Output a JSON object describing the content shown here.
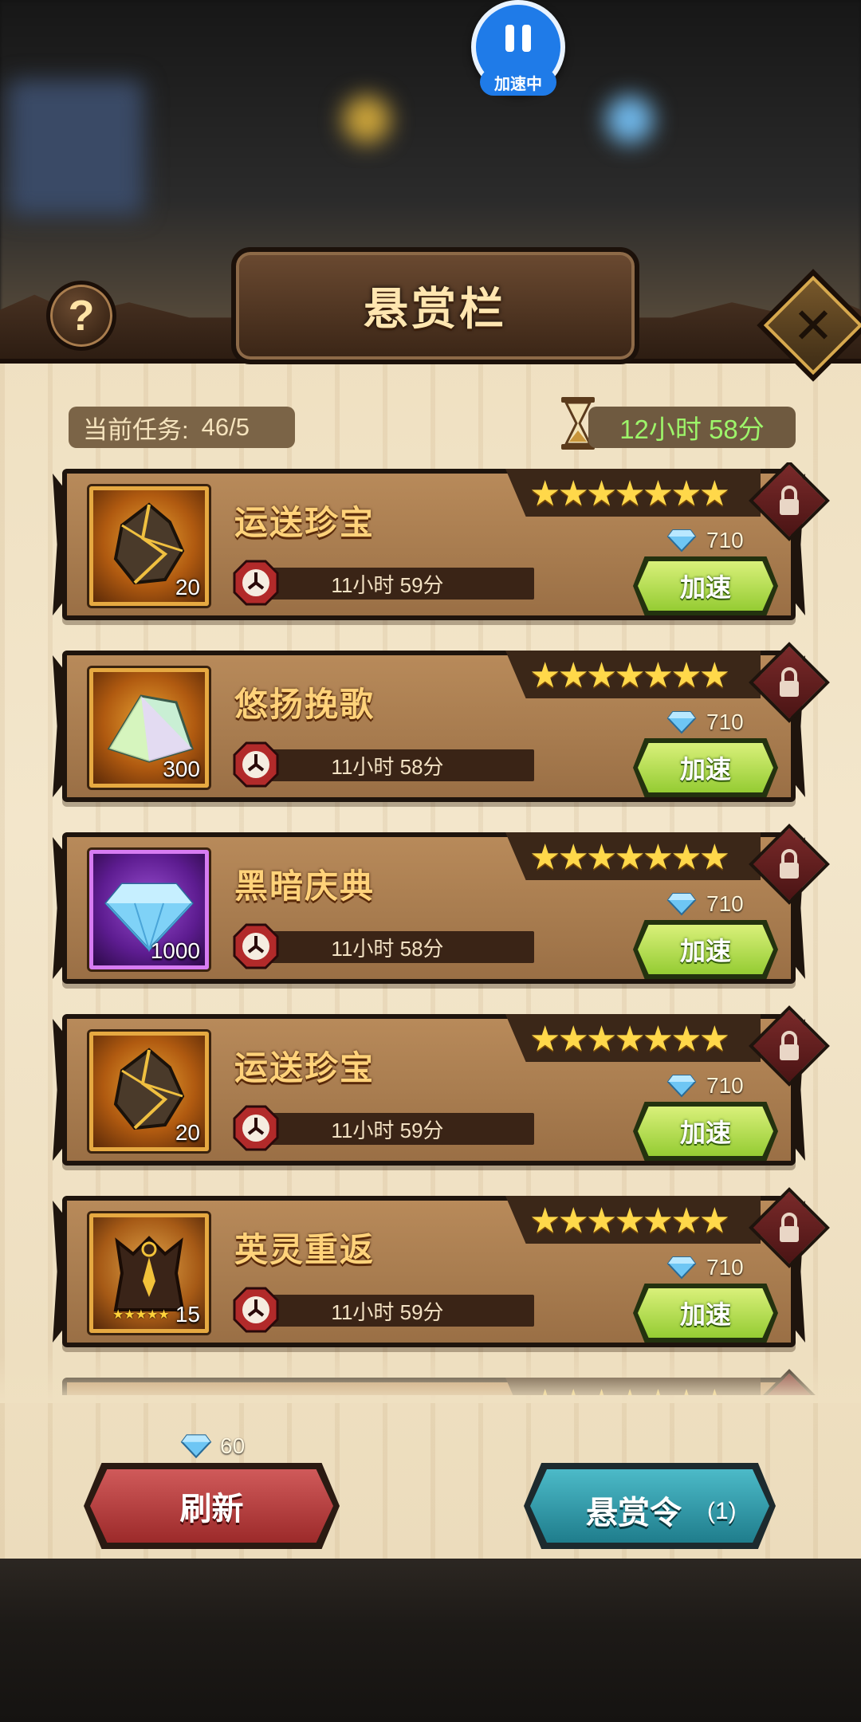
{
  "speed_indicator": {
    "label": "加速中"
  },
  "header": {
    "title": "悬赏栏",
    "help_symbol": "?",
    "close_symbol": "✕"
  },
  "info": {
    "current_task_label": "当前任务:",
    "current_task_value": "46/5",
    "refresh_timer": "12小时 58分"
  },
  "cards": [
    {
      "title": "运送珍宝",
      "item_icon": "ore-chunk-icon",
      "frame": "gold",
      "qty": "20",
      "star_count": 7,
      "gem_cost": "710",
      "time": "11小时 59分",
      "button": "加速"
    },
    {
      "title": "悠扬挽歌",
      "item_icon": "crystal-shard-icon",
      "frame": "gold",
      "qty": "300",
      "star_count": 7,
      "gem_cost": "710",
      "time": "11小时 58分",
      "button": "加速"
    },
    {
      "title": "黑暗庆典",
      "item_icon": "diamond-icon",
      "frame": "purple",
      "qty": "1000",
      "star_count": 7,
      "gem_cost": "710",
      "time": "11小时 58分",
      "button": "加速"
    },
    {
      "title": "运送珍宝",
      "item_icon": "ore-chunk-icon",
      "frame": "gold",
      "qty": "20",
      "star_count": 7,
      "gem_cost": "710",
      "time": "11小时 59分",
      "button": "加速"
    },
    {
      "title": "英灵重返",
      "item_icon": "hero-soul-icon",
      "frame": "gold2",
      "qty": "15",
      "star_count": 7,
      "gem_cost": "710",
      "time": "11小时 59分",
      "button": "加速"
    }
  ],
  "footer": {
    "refresh_cost": "60",
    "refresh_label": "刷新",
    "bounty_label": "悬赏令",
    "bounty_count": "(1)"
  },
  "colors": {
    "panel": "#efe0c1",
    "card": "#b08455",
    "accent_green": "#9df56a",
    "refresh_red": "#b23a3a",
    "bounty_teal": "#2d9aa8"
  }
}
